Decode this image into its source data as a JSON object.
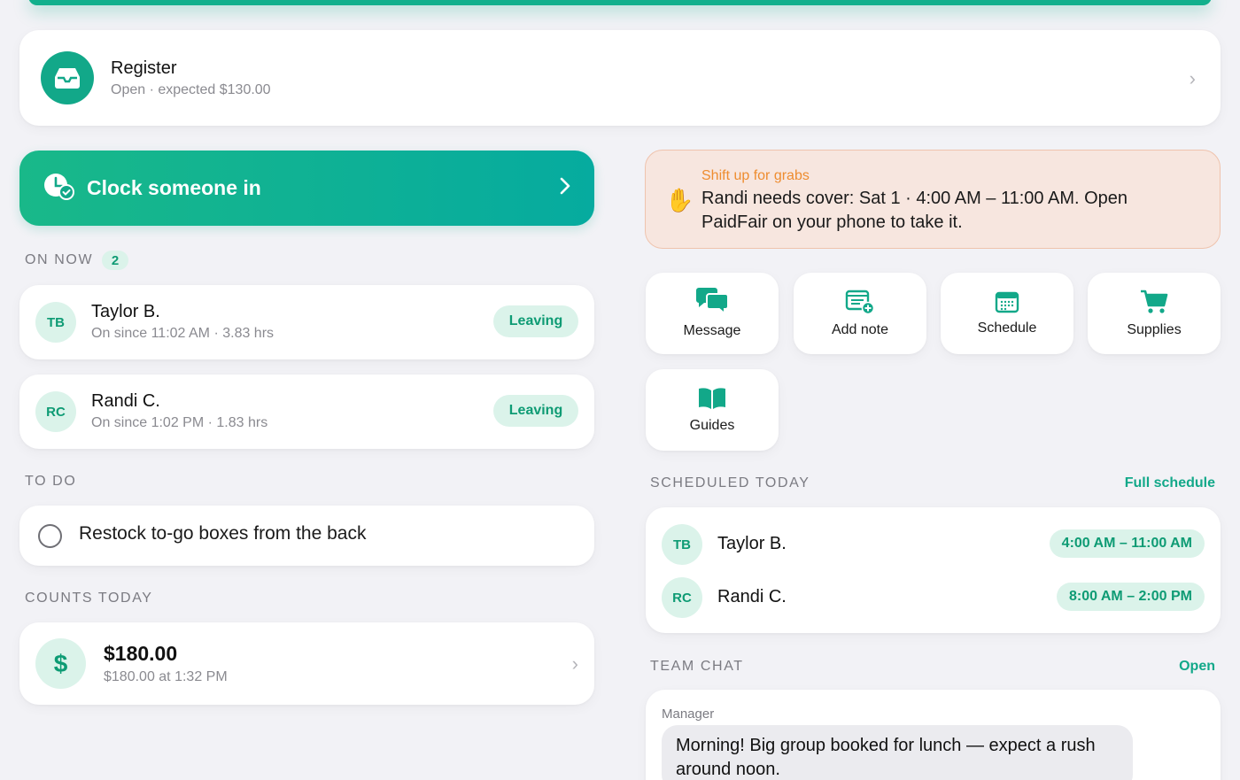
{
  "register": {
    "title": "Register",
    "subtitle": "Open · expected $130.00"
  },
  "clock_in": {
    "label": "Clock someone in"
  },
  "on_now": {
    "label": "ON NOW",
    "count": "2",
    "people": [
      {
        "initials": "TB",
        "name": "Taylor B.",
        "since": "On since 11:02 AM · 3.83 hrs",
        "action": "Leaving"
      },
      {
        "initials": "RC",
        "name": "Randi C.",
        "since": "On since 1:02 PM · 1.83 hrs",
        "action": "Leaving"
      }
    ]
  },
  "todo": {
    "label": "TO DO",
    "items": [
      {
        "text": "Restock to-go boxes from the back"
      }
    ]
  },
  "counts": {
    "label": "COUNTS TODAY",
    "amount": "$180.00",
    "detail": "$180.00 at 1:32 PM",
    "icon": "$"
  },
  "alert": {
    "heading": "Shift up for grabs",
    "body": "Randi needs cover: Sat 1 · 4:00 AM – 11:00 AM. Open PaidFair on your phone to take it.",
    "icon": "raised-hand-icon"
  },
  "actions": [
    {
      "label": "Message",
      "icon": "message-icon"
    },
    {
      "label": "Add note",
      "icon": "add-note-icon"
    },
    {
      "label": "Schedule",
      "icon": "calendar-icon"
    },
    {
      "label": "Supplies",
      "icon": "cart-icon"
    },
    {
      "label": "Guides",
      "icon": "book-icon"
    }
  ],
  "scheduled": {
    "label": "SCHEDULED TODAY",
    "link": "Full schedule",
    "people": [
      {
        "initials": "TB",
        "name": "Taylor B.",
        "time": "4:00 AM – 11:00 AM"
      },
      {
        "initials": "RC",
        "name": "Randi C.",
        "time": "8:00 AM – 2:00 PM"
      }
    ]
  },
  "team_chat": {
    "label": "TEAM CHAT",
    "link": "Open",
    "messages": [
      {
        "from": "Manager",
        "text": "Morning! Big group booked for lunch — expect a rush around noon."
      }
    ]
  },
  "colors": {
    "accent": "#12a889",
    "accent_light": "#dbf3ea",
    "alert_bg": "#f7e6df",
    "alert_heading": "#ee8c2f"
  }
}
